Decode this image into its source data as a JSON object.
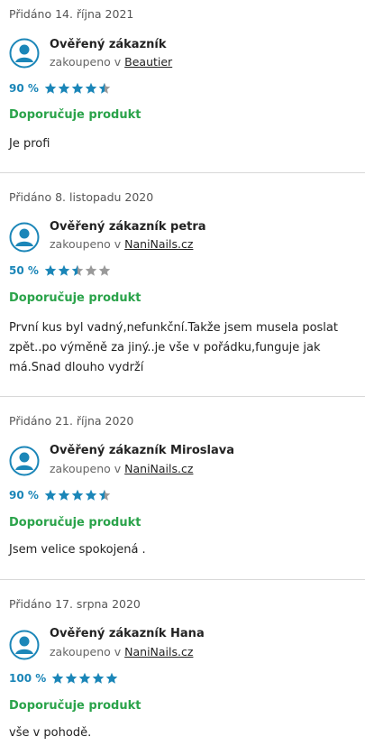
{
  "reviews": [
    {
      "date": "Přidáno 14. října 2021",
      "name": "Ověřený zákazník",
      "bought_prefix": "zakoupeno v",
      "shop": "Beautier",
      "percent": "90 %",
      "rating": 4.5,
      "recommend": "Doporučuje produkt",
      "text": "Je profi"
    },
    {
      "date": "Přidáno 8. listopadu 2020",
      "name": "Ověřený zákazník petra",
      "bought_prefix": "zakoupeno v",
      "shop": "NaniNails.cz",
      "percent": "50 %",
      "rating": 2.5,
      "recommend": "Doporučuje produkt",
      "text": "První kus byl vadný,nefunkční.Takže jsem musela poslat zpět..po výměně za jiný..je vše v pořádku,funguje jak má.Snad dlouho vydrží"
    },
    {
      "date": "Přidáno 21. října 2020",
      "name": "Ověřený zákazník Miroslava",
      "bought_prefix": "zakoupeno v",
      "shop": "NaniNails.cz",
      "percent": "90 %",
      "rating": 4.5,
      "recommend": "Doporučuje produkt",
      "text": "Jsem velice spokojená ."
    },
    {
      "date": "Přidáno 17. srpna 2020",
      "name": "Ověřený zákazník Hana",
      "bought_prefix": "zakoupeno v",
      "shop": "NaniNails.cz",
      "percent": "100 %",
      "rating": 5,
      "recommend": "Doporučuje produkt",
      "text": "vše v pohodě."
    }
  ],
  "colors": {
    "star": "#1b86b8",
    "star_empty": "#9a9a9a",
    "recommend": "#2aa34a",
    "avatar": "#1b86b8"
  },
  "icons": {
    "avatar": "user-avatar-icon",
    "star": "star-icon"
  }
}
